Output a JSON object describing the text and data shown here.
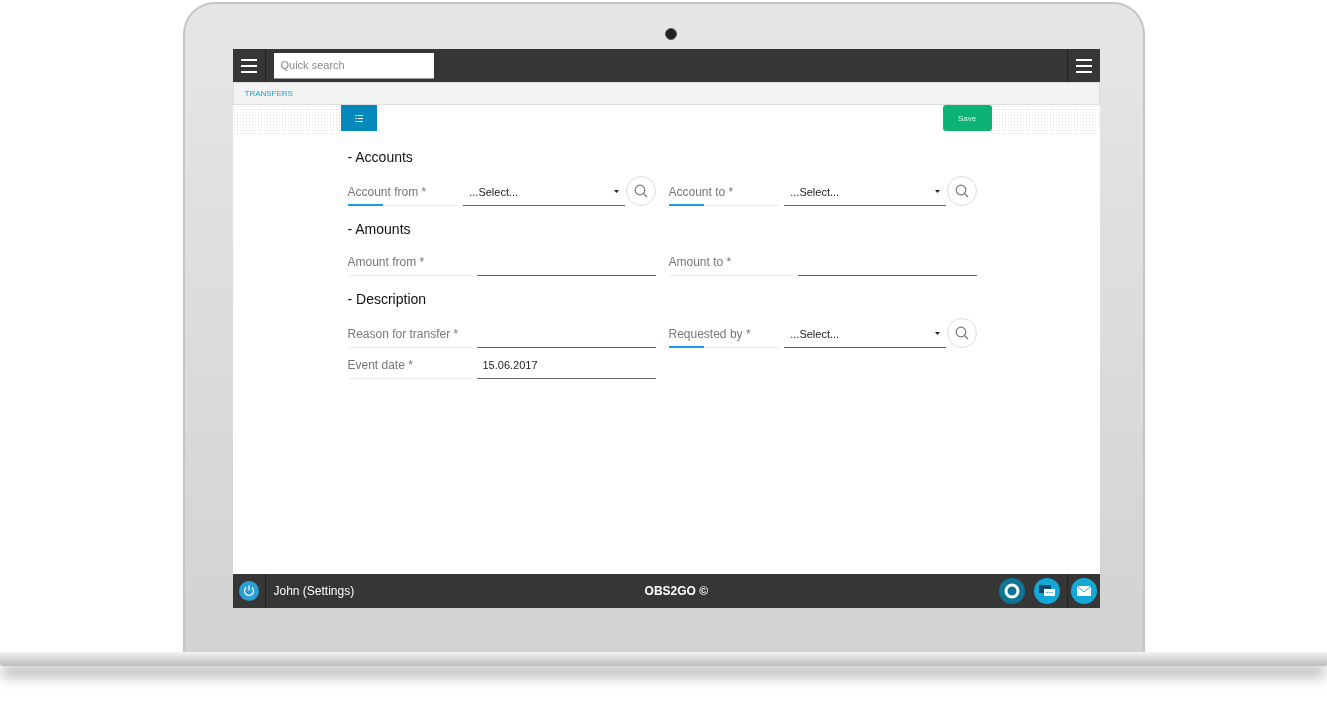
{
  "topbar": {
    "search": {
      "placeholder": "Quick search"
    }
  },
  "breadcrumb": "TRANSFERS",
  "toolbar": {
    "save": "Save"
  },
  "sections": [
    {
      "title": "- Accounts",
      "rows": [
        [
          {
            "label": "Account from *",
            "kind": "select",
            "value": "...Select..."
          },
          {
            "label": "Account to *",
            "kind": "select",
            "value": "...Select..."
          }
        ]
      ]
    },
    {
      "title": "- Amounts",
      "rows": [
        [
          {
            "label": "Amount from *",
            "kind": "text"
          },
          {
            "label": "Amount to *",
            "kind": "text"
          }
        ]
      ]
    },
    {
      "title": "- Description",
      "rows": [
        [
          {
            "label": "Reason for transfer *",
            "kind": "text"
          },
          {
            "label": "Requested by *",
            "kind": "select",
            "value": "...Select..."
          }
        ],
        [
          {
            "label": "Event date *",
            "kind": "text",
            "value": "15.06.2017"
          }
        ]
      ]
    }
  ],
  "footer": {
    "user": "John (Settings)",
    "brand": "OBS2GO ©"
  }
}
